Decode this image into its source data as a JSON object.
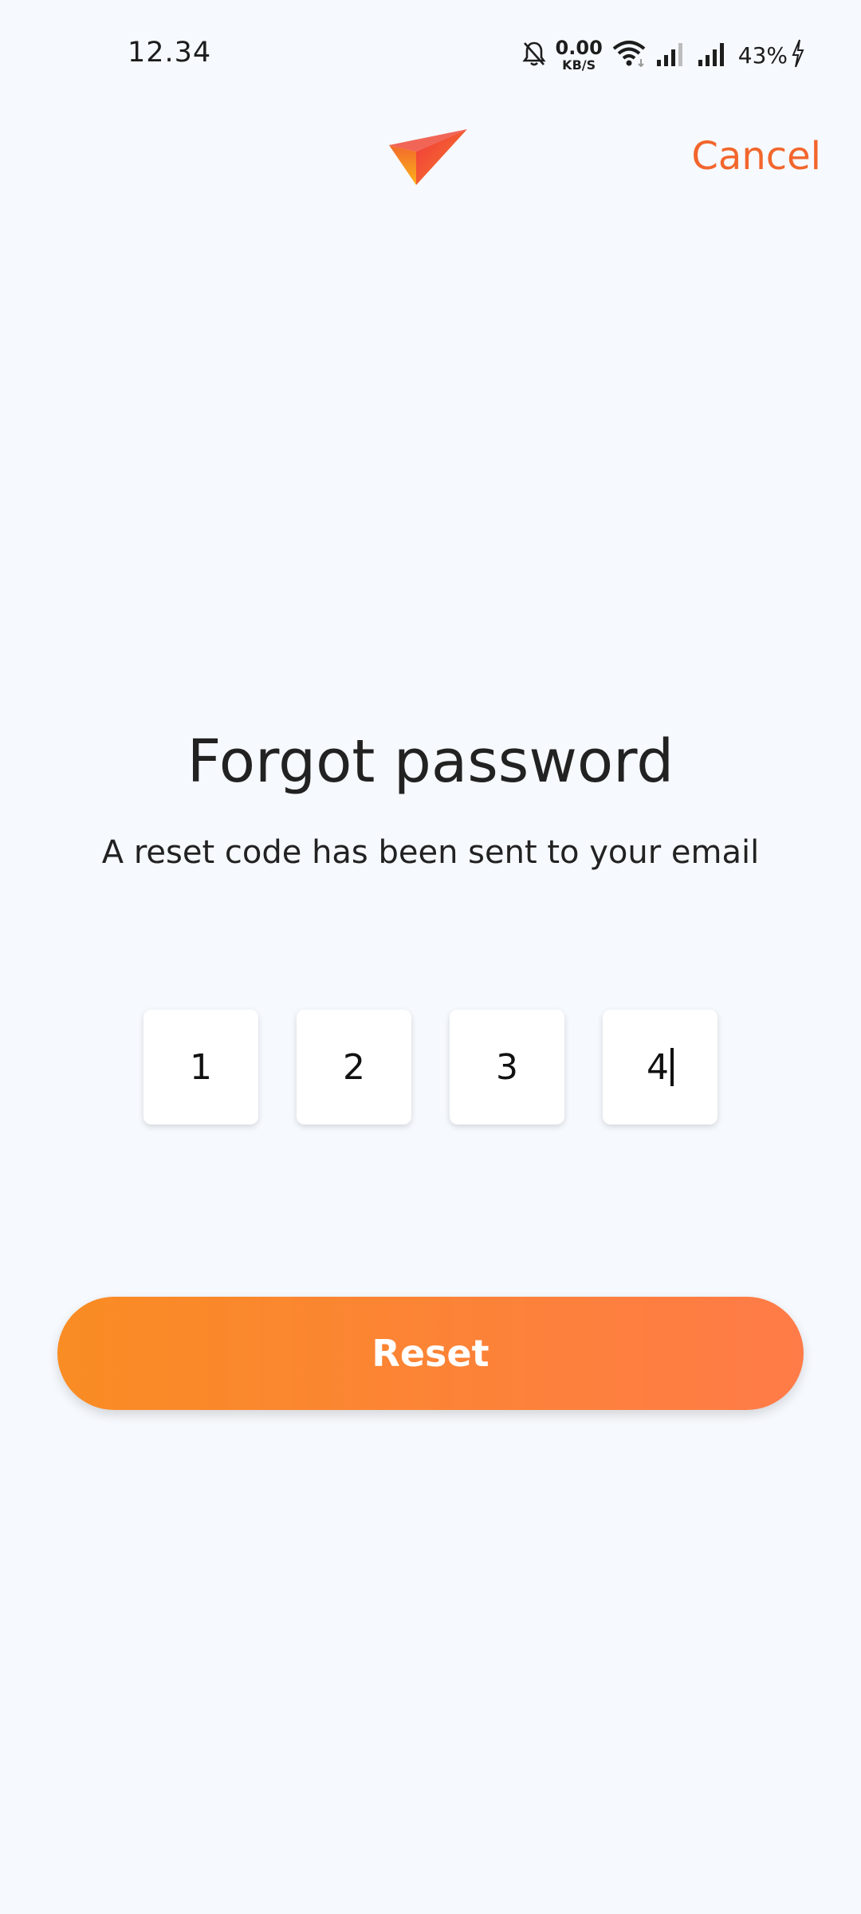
{
  "status_bar": {
    "time": "12.34",
    "net_speed_value": "0.00",
    "net_speed_unit": "KB/S",
    "battery": "43%",
    "icons": [
      "bell-muted-icon",
      "wifi-icon",
      "signal-icon",
      "signal-icon",
      "charging-icon"
    ]
  },
  "header": {
    "cancel_label": "Cancel",
    "logo_icon": "checkmark-logo"
  },
  "main": {
    "title": "Forgot password",
    "subtitle": "A reset code has been sent to your email",
    "code_digits": [
      "1",
      "2",
      "3",
      "4"
    ],
    "reset_label": "Reset"
  },
  "colors": {
    "background": "#F6F9FD",
    "accent": "#F2662C",
    "button_gradient_start": "#F98C23",
    "button_gradient_end": "#FF7B48"
  }
}
